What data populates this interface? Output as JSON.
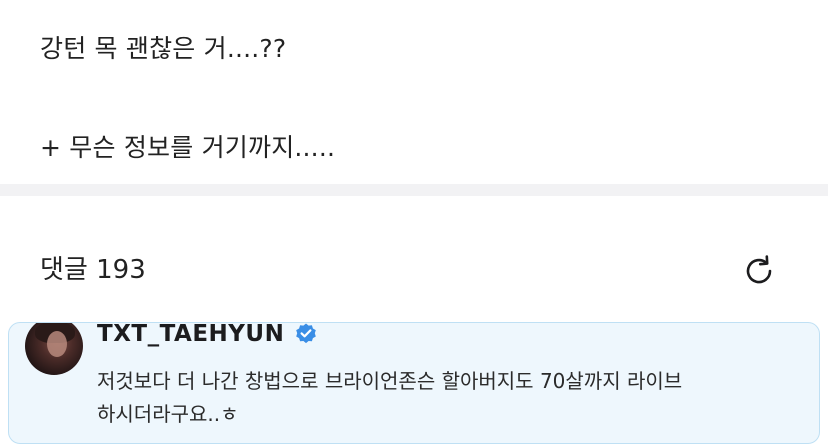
{
  "post": {
    "line1": "강턴 목 괜찮은 거....??",
    "line2": "+ 무슨 정보를 거기까지....."
  },
  "comments": {
    "label": "댓글 193",
    "refresh_icon": "refresh-icon"
  },
  "comment": {
    "author": "TXT_TAEHYUN",
    "verified_icon": "verified-badge-icon",
    "text_line1": "저것보다 더 나간 창법으로 브라이언존슨 할아버지도 70살까지 라이브",
    "text_line2": "하시더라구요..ㅎ"
  },
  "colors": {
    "card_bg": "#eef7fd",
    "card_border": "#bfe0f4",
    "verified": "#3a8ee6",
    "divider": "#f2f2f4"
  }
}
